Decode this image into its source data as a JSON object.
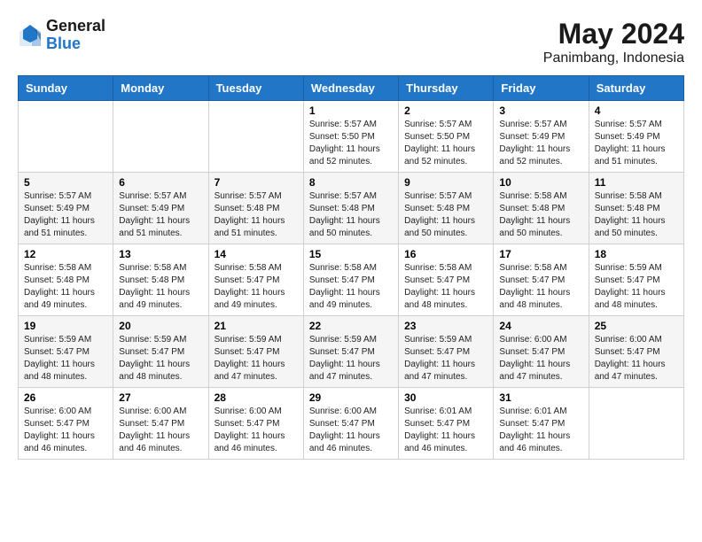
{
  "header": {
    "logo_line1": "General",
    "logo_line2": "Blue",
    "title": "May 2024",
    "subtitle": "Panimbang, Indonesia"
  },
  "weekdays": [
    "Sunday",
    "Monday",
    "Tuesday",
    "Wednesday",
    "Thursday",
    "Friday",
    "Saturday"
  ],
  "weeks": [
    [
      {
        "day": "",
        "info": ""
      },
      {
        "day": "",
        "info": ""
      },
      {
        "day": "",
        "info": ""
      },
      {
        "day": "1",
        "info": "Sunrise: 5:57 AM\nSunset: 5:50 PM\nDaylight: 11 hours\nand 52 minutes."
      },
      {
        "day": "2",
        "info": "Sunrise: 5:57 AM\nSunset: 5:50 PM\nDaylight: 11 hours\nand 52 minutes."
      },
      {
        "day": "3",
        "info": "Sunrise: 5:57 AM\nSunset: 5:49 PM\nDaylight: 11 hours\nand 52 minutes."
      },
      {
        "day": "4",
        "info": "Sunrise: 5:57 AM\nSunset: 5:49 PM\nDaylight: 11 hours\nand 51 minutes."
      }
    ],
    [
      {
        "day": "5",
        "info": "Sunrise: 5:57 AM\nSunset: 5:49 PM\nDaylight: 11 hours\nand 51 minutes."
      },
      {
        "day": "6",
        "info": "Sunrise: 5:57 AM\nSunset: 5:49 PM\nDaylight: 11 hours\nand 51 minutes."
      },
      {
        "day": "7",
        "info": "Sunrise: 5:57 AM\nSunset: 5:48 PM\nDaylight: 11 hours\nand 51 minutes."
      },
      {
        "day": "8",
        "info": "Sunrise: 5:57 AM\nSunset: 5:48 PM\nDaylight: 11 hours\nand 50 minutes."
      },
      {
        "day": "9",
        "info": "Sunrise: 5:57 AM\nSunset: 5:48 PM\nDaylight: 11 hours\nand 50 minutes."
      },
      {
        "day": "10",
        "info": "Sunrise: 5:58 AM\nSunset: 5:48 PM\nDaylight: 11 hours\nand 50 minutes."
      },
      {
        "day": "11",
        "info": "Sunrise: 5:58 AM\nSunset: 5:48 PM\nDaylight: 11 hours\nand 50 minutes."
      }
    ],
    [
      {
        "day": "12",
        "info": "Sunrise: 5:58 AM\nSunset: 5:48 PM\nDaylight: 11 hours\nand 49 minutes."
      },
      {
        "day": "13",
        "info": "Sunrise: 5:58 AM\nSunset: 5:48 PM\nDaylight: 11 hours\nand 49 minutes."
      },
      {
        "day": "14",
        "info": "Sunrise: 5:58 AM\nSunset: 5:47 PM\nDaylight: 11 hours\nand 49 minutes."
      },
      {
        "day": "15",
        "info": "Sunrise: 5:58 AM\nSunset: 5:47 PM\nDaylight: 11 hours\nand 49 minutes."
      },
      {
        "day": "16",
        "info": "Sunrise: 5:58 AM\nSunset: 5:47 PM\nDaylight: 11 hours\nand 48 minutes."
      },
      {
        "day": "17",
        "info": "Sunrise: 5:58 AM\nSunset: 5:47 PM\nDaylight: 11 hours\nand 48 minutes."
      },
      {
        "day": "18",
        "info": "Sunrise: 5:59 AM\nSunset: 5:47 PM\nDaylight: 11 hours\nand 48 minutes."
      }
    ],
    [
      {
        "day": "19",
        "info": "Sunrise: 5:59 AM\nSunset: 5:47 PM\nDaylight: 11 hours\nand 48 minutes."
      },
      {
        "day": "20",
        "info": "Sunrise: 5:59 AM\nSunset: 5:47 PM\nDaylight: 11 hours\nand 48 minutes."
      },
      {
        "day": "21",
        "info": "Sunrise: 5:59 AM\nSunset: 5:47 PM\nDaylight: 11 hours\nand 47 minutes."
      },
      {
        "day": "22",
        "info": "Sunrise: 5:59 AM\nSunset: 5:47 PM\nDaylight: 11 hours\nand 47 minutes."
      },
      {
        "day": "23",
        "info": "Sunrise: 5:59 AM\nSunset: 5:47 PM\nDaylight: 11 hours\nand 47 minutes."
      },
      {
        "day": "24",
        "info": "Sunrise: 6:00 AM\nSunset: 5:47 PM\nDaylight: 11 hours\nand 47 minutes."
      },
      {
        "day": "25",
        "info": "Sunrise: 6:00 AM\nSunset: 5:47 PM\nDaylight: 11 hours\nand 47 minutes."
      }
    ],
    [
      {
        "day": "26",
        "info": "Sunrise: 6:00 AM\nSunset: 5:47 PM\nDaylight: 11 hours\nand 46 minutes."
      },
      {
        "day": "27",
        "info": "Sunrise: 6:00 AM\nSunset: 5:47 PM\nDaylight: 11 hours\nand 46 minutes."
      },
      {
        "day": "28",
        "info": "Sunrise: 6:00 AM\nSunset: 5:47 PM\nDaylight: 11 hours\nand 46 minutes."
      },
      {
        "day": "29",
        "info": "Sunrise: 6:00 AM\nSunset: 5:47 PM\nDaylight: 11 hours\nand 46 minutes."
      },
      {
        "day": "30",
        "info": "Sunrise: 6:01 AM\nSunset: 5:47 PM\nDaylight: 11 hours\nand 46 minutes."
      },
      {
        "day": "31",
        "info": "Sunrise: 6:01 AM\nSunset: 5:47 PM\nDaylight: 11 hours\nand 46 minutes."
      },
      {
        "day": "",
        "info": ""
      }
    ]
  ]
}
